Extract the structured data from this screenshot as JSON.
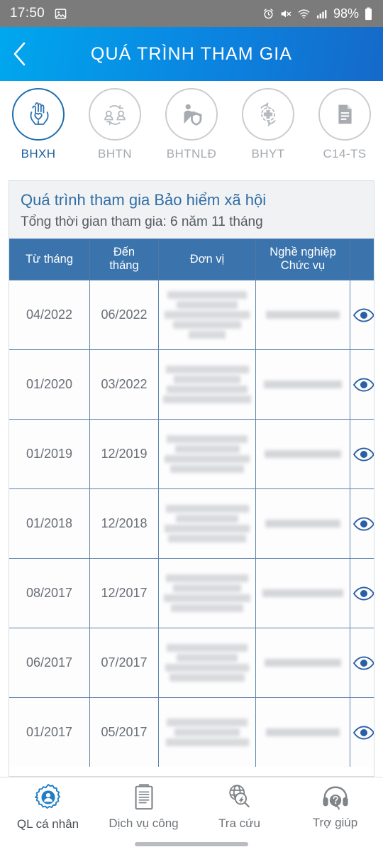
{
  "statusbar": {
    "time": "17:50",
    "battery_percent": "98%",
    "icons": [
      "image-icon",
      "alarm-icon",
      "mute-icon",
      "wifi-icon",
      "signal-icon",
      "battery-icon"
    ]
  },
  "header": {
    "title": "QUÁ TRÌNH THAM GIA",
    "back_icon": "chevron-left-icon",
    "accent": "#0b84e0"
  },
  "categories": [
    {
      "label": "BHXH",
      "icon": "praying-hands-heart-icon",
      "active": true
    },
    {
      "label": "BHTN",
      "icon": "two-people-exchange-icon",
      "active": false
    },
    {
      "label": "BHTNLĐ",
      "icon": "worker-shield-icon",
      "active": false
    },
    {
      "label": "BHYT",
      "icon": "medical-cross-cycle-icon",
      "active": false
    },
    {
      "label": "C14-TS",
      "icon": "document-icon",
      "active": false
    }
  ],
  "card": {
    "title": "Quá trình tham gia Bảo hiểm xã hội",
    "subtitle": "Tổng thời gian tham gia: 6 năm 11 tháng"
  },
  "table": {
    "headers": [
      "Từ tháng",
      "Đến tháng",
      "Đơn vị",
      "Nghề nghiệp\nChức vụ",
      ""
    ],
    "header_lines": {
      "col1": "Từ tháng",
      "col2_line1": "Đến",
      "col2_line2": "tháng",
      "col3": "Đơn vị",
      "col4_line1": "Nghề nghiệp",
      "col4_line2": "Chức vụ"
    },
    "rows": [
      {
        "from": "04/2022",
        "to": "06/2022",
        "unit": "[redacted]",
        "job": "[redacted]",
        "action_icon": "eye-icon"
      },
      {
        "from": "01/2020",
        "to": "03/2022",
        "unit": "[redacted]",
        "job": "[redacted]",
        "action_icon": "eye-icon"
      },
      {
        "from": "01/2019",
        "to": "12/2019",
        "unit": "[redacted]",
        "job": "[redacted]",
        "action_icon": "eye-icon"
      },
      {
        "from": "01/2018",
        "to": "12/2018",
        "unit": "[redacted]",
        "job": "[redacted]",
        "action_icon": "eye-icon"
      },
      {
        "from": "08/2017",
        "to": "12/2017",
        "unit": "[redacted]",
        "job": "[redacted]",
        "action_icon": "eye-icon"
      },
      {
        "from": "06/2017",
        "to": "07/2017",
        "unit": "[redacted]",
        "job": "[redacted]",
        "action_icon": "eye-icon"
      },
      {
        "from": "01/2017",
        "to": "05/2017",
        "unit": "[redacted]",
        "job": "[redacted]",
        "action_icon": "eye-icon"
      }
    ],
    "header_bg": "#3b74ad",
    "eye_color": "#2a5fa6"
  },
  "bottomnav": [
    {
      "label": "QL cá nhân",
      "icon": "gear-person-icon",
      "active": true
    },
    {
      "label": "Dịch vụ công",
      "icon": "clipboard-icon",
      "active": false
    },
    {
      "label": "Tra cứu",
      "icon": "globe-search-icon",
      "active": false
    },
    {
      "label": "Trợ giúp",
      "icon": "headset-support-icon",
      "active": false
    }
  ]
}
